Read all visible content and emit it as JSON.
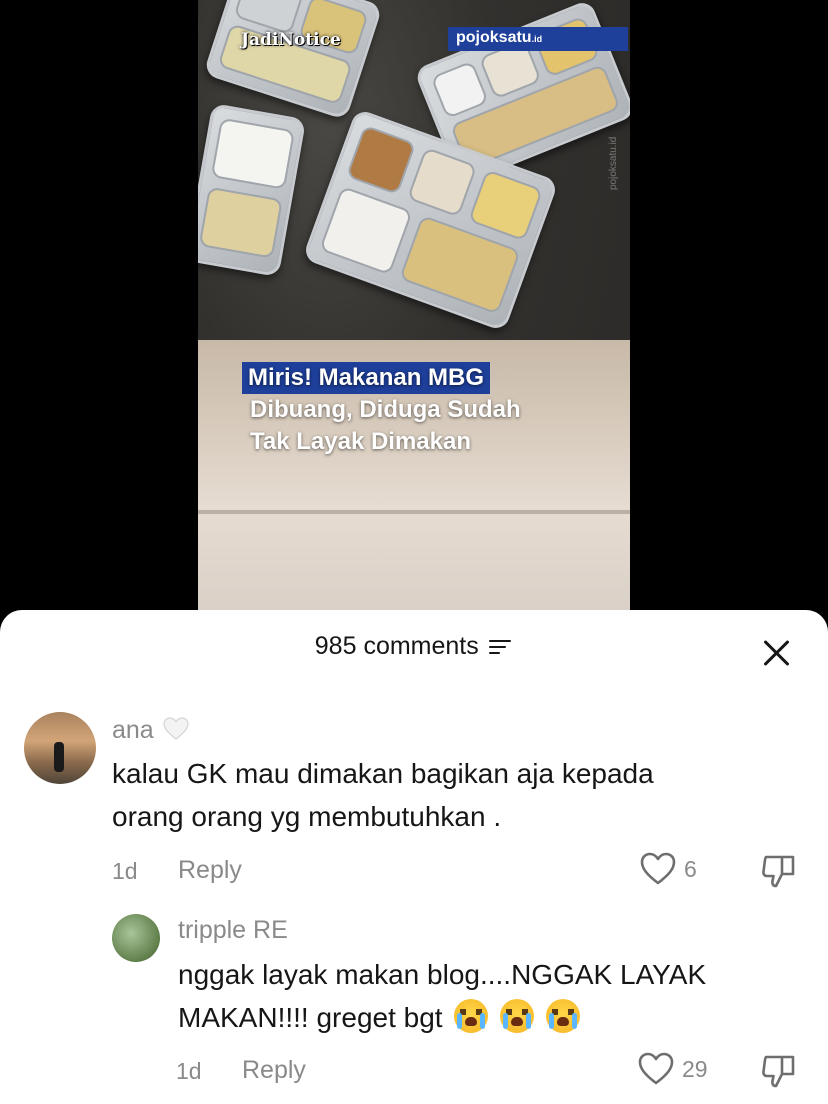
{
  "video": {
    "watermark_left": "JadiNotice",
    "watermark_right": "pojoksatu",
    "watermark_right_suffix": ".id",
    "watermark_side": "pojoksatu.id",
    "headline_line1": "Miris! Makanan MBG",
    "headline_line2": "Dibuang, Diduga Sudah",
    "headline_line3": "Tak Layak Dimakan"
  },
  "comments_sheet": {
    "count_label": "985 comments",
    "comments": [
      {
        "username": "ana",
        "username_emoji": "white-heart-icon",
        "text_line1": "kalau GK mau dimakan bagikan aja kepada",
        "text_line2": "orang orang yg membutuhkan .",
        "time": "1d",
        "reply_label": "Reply",
        "likes": "6"
      },
      {
        "username": "tripple RE",
        "text_line1": "nggak layak makan blog....NGGAK LAYAK",
        "text_line2": "MAKAN!!!! greget bgt",
        "text_emojis": [
          "loudly-crying-face-icon",
          "loudly-crying-face-icon",
          "loudly-crying-face-icon"
        ],
        "time": "1d",
        "reply_label": "Reply",
        "likes": "29"
      }
    ]
  },
  "colors": {
    "headline_highlight": "#1e3f9a",
    "text_primary": "#161616",
    "text_secondary": "#8a8a8a"
  }
}
